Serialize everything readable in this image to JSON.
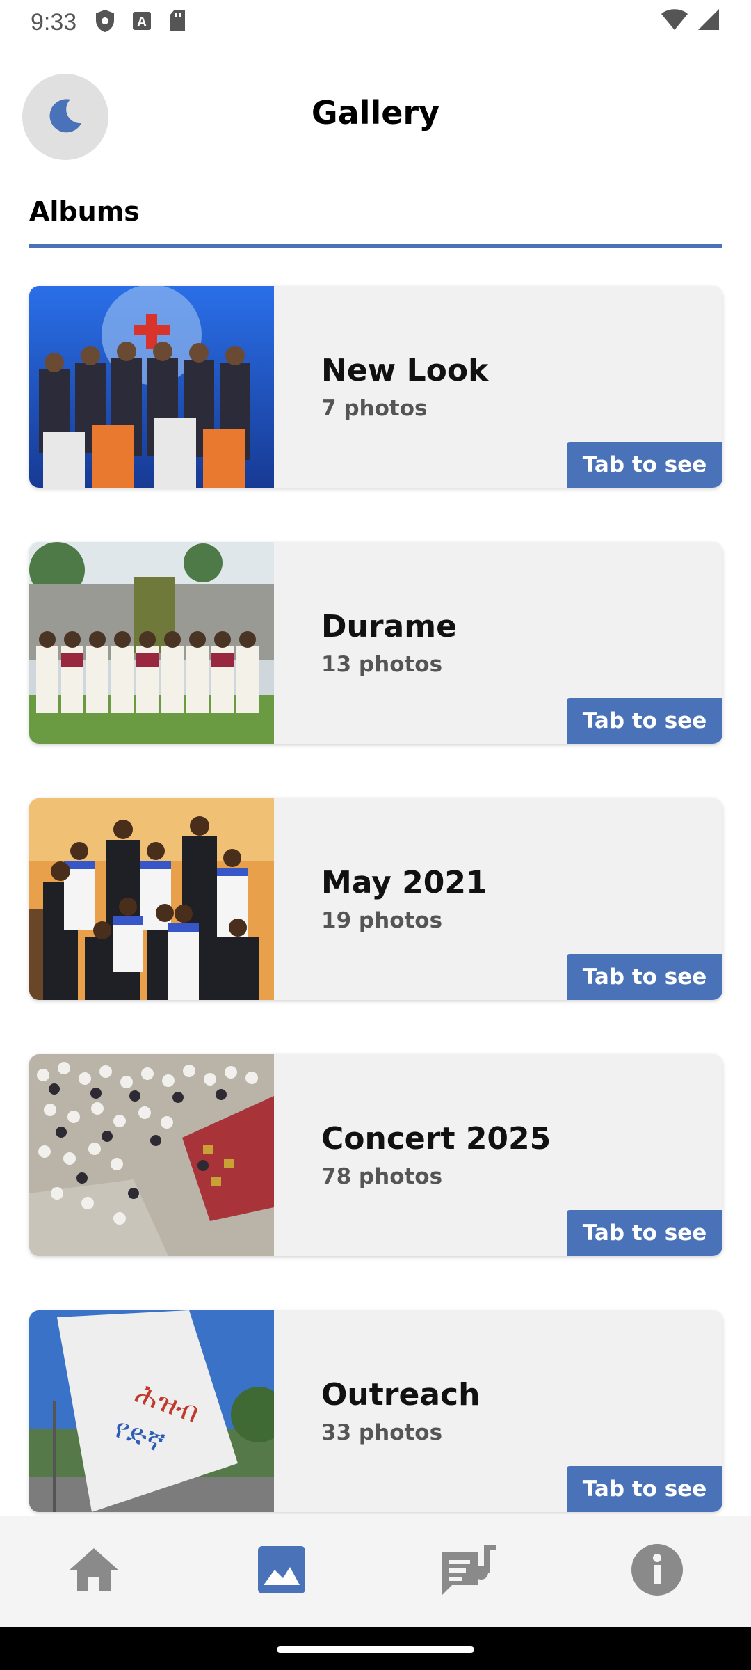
{
  "status_bar": {
    "time": "9:33",
    "icons_left": [
      "shield-icon",
      "a-icon",
      "sd-card-icon"
    ],
    "icons_right": [
      "wifi-icon",
      "signal-icon"
    ]
  },
  "header": {
    "title": "Gallery",
    "theme_toggle_icon": "moon-icon"
  },
  "tabs": {
    "albums_label": "Albums",
    "underline_color": "#4a72b8"
  },
  "albums": [
    {
      "name": "New Look",
      "count": "7 photos",
      "cta": "Tab to see",
      "thumb": "choir-group-blue-backdrop"
    },
    {
      "name": "Durame",
      "count": "13 photos",
      "cta": "Tab to see",
      "thumb": "choir-white-robes-outdoors"
    },
    {
      "name": "May 2021",
      "count": "19 photos",
      "cta": "Tab to see",
      "thumb": "group-photo-indoors"
    },
    {
      "name": "Concert 2025",
      "count": "78 photos",
      "cta": "Tab to see",
      "thumb": "concert-crowd-overhead"
    },
    {
      "name": "Outreach",
      "count": "33 photos",
      "cta": "Tab to see",
      "thumb": "white-flag-outdoors"
    }
  ],
  "bottom_nav": {
    "items": [
      "home-icon",
      "gallery-icon",
      "lyrics-icon",
      "info-icon"
    ],
    "active": "gallery-icon",
    "active_color": "#4a72b8",
    "inactive_color": "#8a8a8a"
  }
}
